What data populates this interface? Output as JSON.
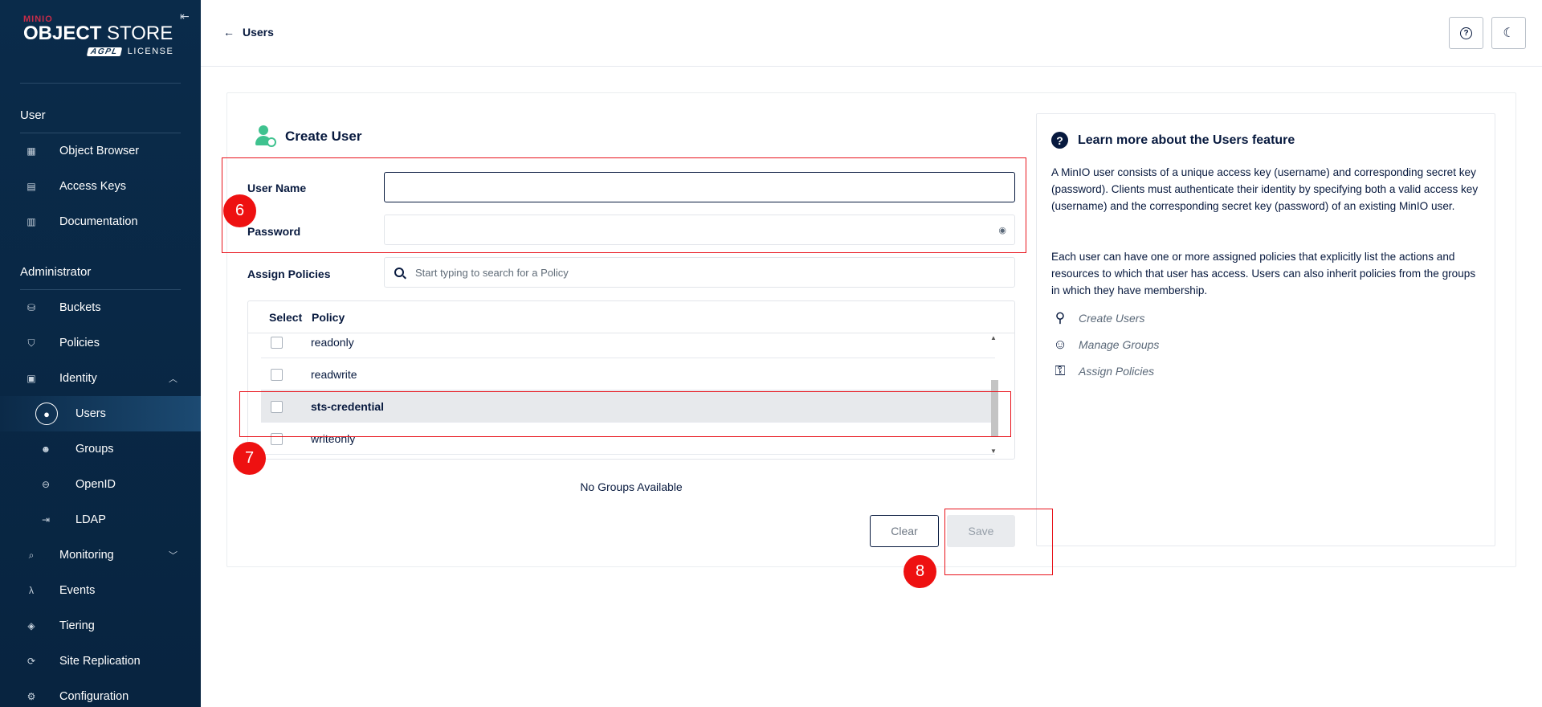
{
  "sidebar": {
    "logo": {
      "brand": "MINIO",
      "product_bold": "OBJECT",
      "product_light": "STORE",
      "edition": "AGPL",
      "license": "LICENSE"
    },
    "sections": {
      "user": "User",
      "admin": "Administrator"
    },
    "user_items": [
      {
        "label": "Object Browser",
        "icon": "object-browser-icon"
      },
      {
        "label": "Access Keys",
        "icon": "access-keys-icon"
      },
      {
        "label": "Documentation",
        "icon": "documentation-icon"
      }
    ],
    "admin_items": [
      {
        "label": "Buckets",
        "icon": "buckets-icon"
      },
      {
        "label": "Policies",
        "icon": "policies-icon"
      },
      {
        "label": "Identity",
        "icon": "identity-icon"
      },
      {
        "label": "Users",
        "icon": "user-icon"
      },
      {
        "label": "Groups",
        "icon": "groups-icon"
      },
      {
        "label": "OpenID",
        "icon": "openid-icon"
      },
      {
        "label": "LDAP",
        "icon": "ldap-icon"
      },
      {
        "label": "Monitoring",
        "icon": "monitoring-icon"
      },
      {
        "label": "Events",
        "icon": "lambda-icon"
      },
      {
        "label": "Tiering",
        "icon": "tiering-icon"
      },
      {
        "label": "Site Replication",
        "icon": "replication-icon"
      },
      {
        "label": "Configuration",
        "icon": "gear-icon"
      }
    ]
  },
  "header": {
    "back_label": "Users"
  },
  "form": {
    "title": "Create User",
    "username_label": "User Name",
    "username_value": "",
    "password_label": "Password",
    "password_value": "",
    "policies_label": "Assign Policies",
    "policy_search_placeholder": "Start typing to search for a Policy",
    "table": {
      "headers": [
        "Select",
        "Policy"
      ],
      "rows": [
        {
          "name": "readonly",
          "checked": false
        },
        {
          "name": "readwrite",
          "checked": false
        },
        {
          "name": "sts-credential",
          "checked": false
        },
        {
          "name": "writeonly",
          "checked": false
        }
      ]
    },
    "no_groups": "No Groups Available",
    "clear_label": "Clear",
    "save_label": "Save"
  },
  "help": {
    "title": "Learn more about the Users feature",
    "paragraph1": "A MinIO user consists of a unique access key (username) and corresponding secret key (password). Clients must authenticate their identity by specifying both a valid access key (username) and the corresponding secret key (password) of an existing MinIO user.",
    "paragraph2": "Each user can have one or more assigned policies that explicitly list the actions and resources to which that user has access. Users can also inherit policies from the groups in which they have membership.",
    "links": [
      "Create Users",
      "Manage Groups",
      "Assign Policies"
    ]
  },
  "annotations": {
    "step6": "6",
    "step7": "7",
    "step8": "8"
  },
  "colors": {
    "sidebar": "#0a2b4a",
    "accent_green": "#3fc28f",
    "annotation_red": "#e8141c",
    "text_dark": "#07193e"
  }
}
